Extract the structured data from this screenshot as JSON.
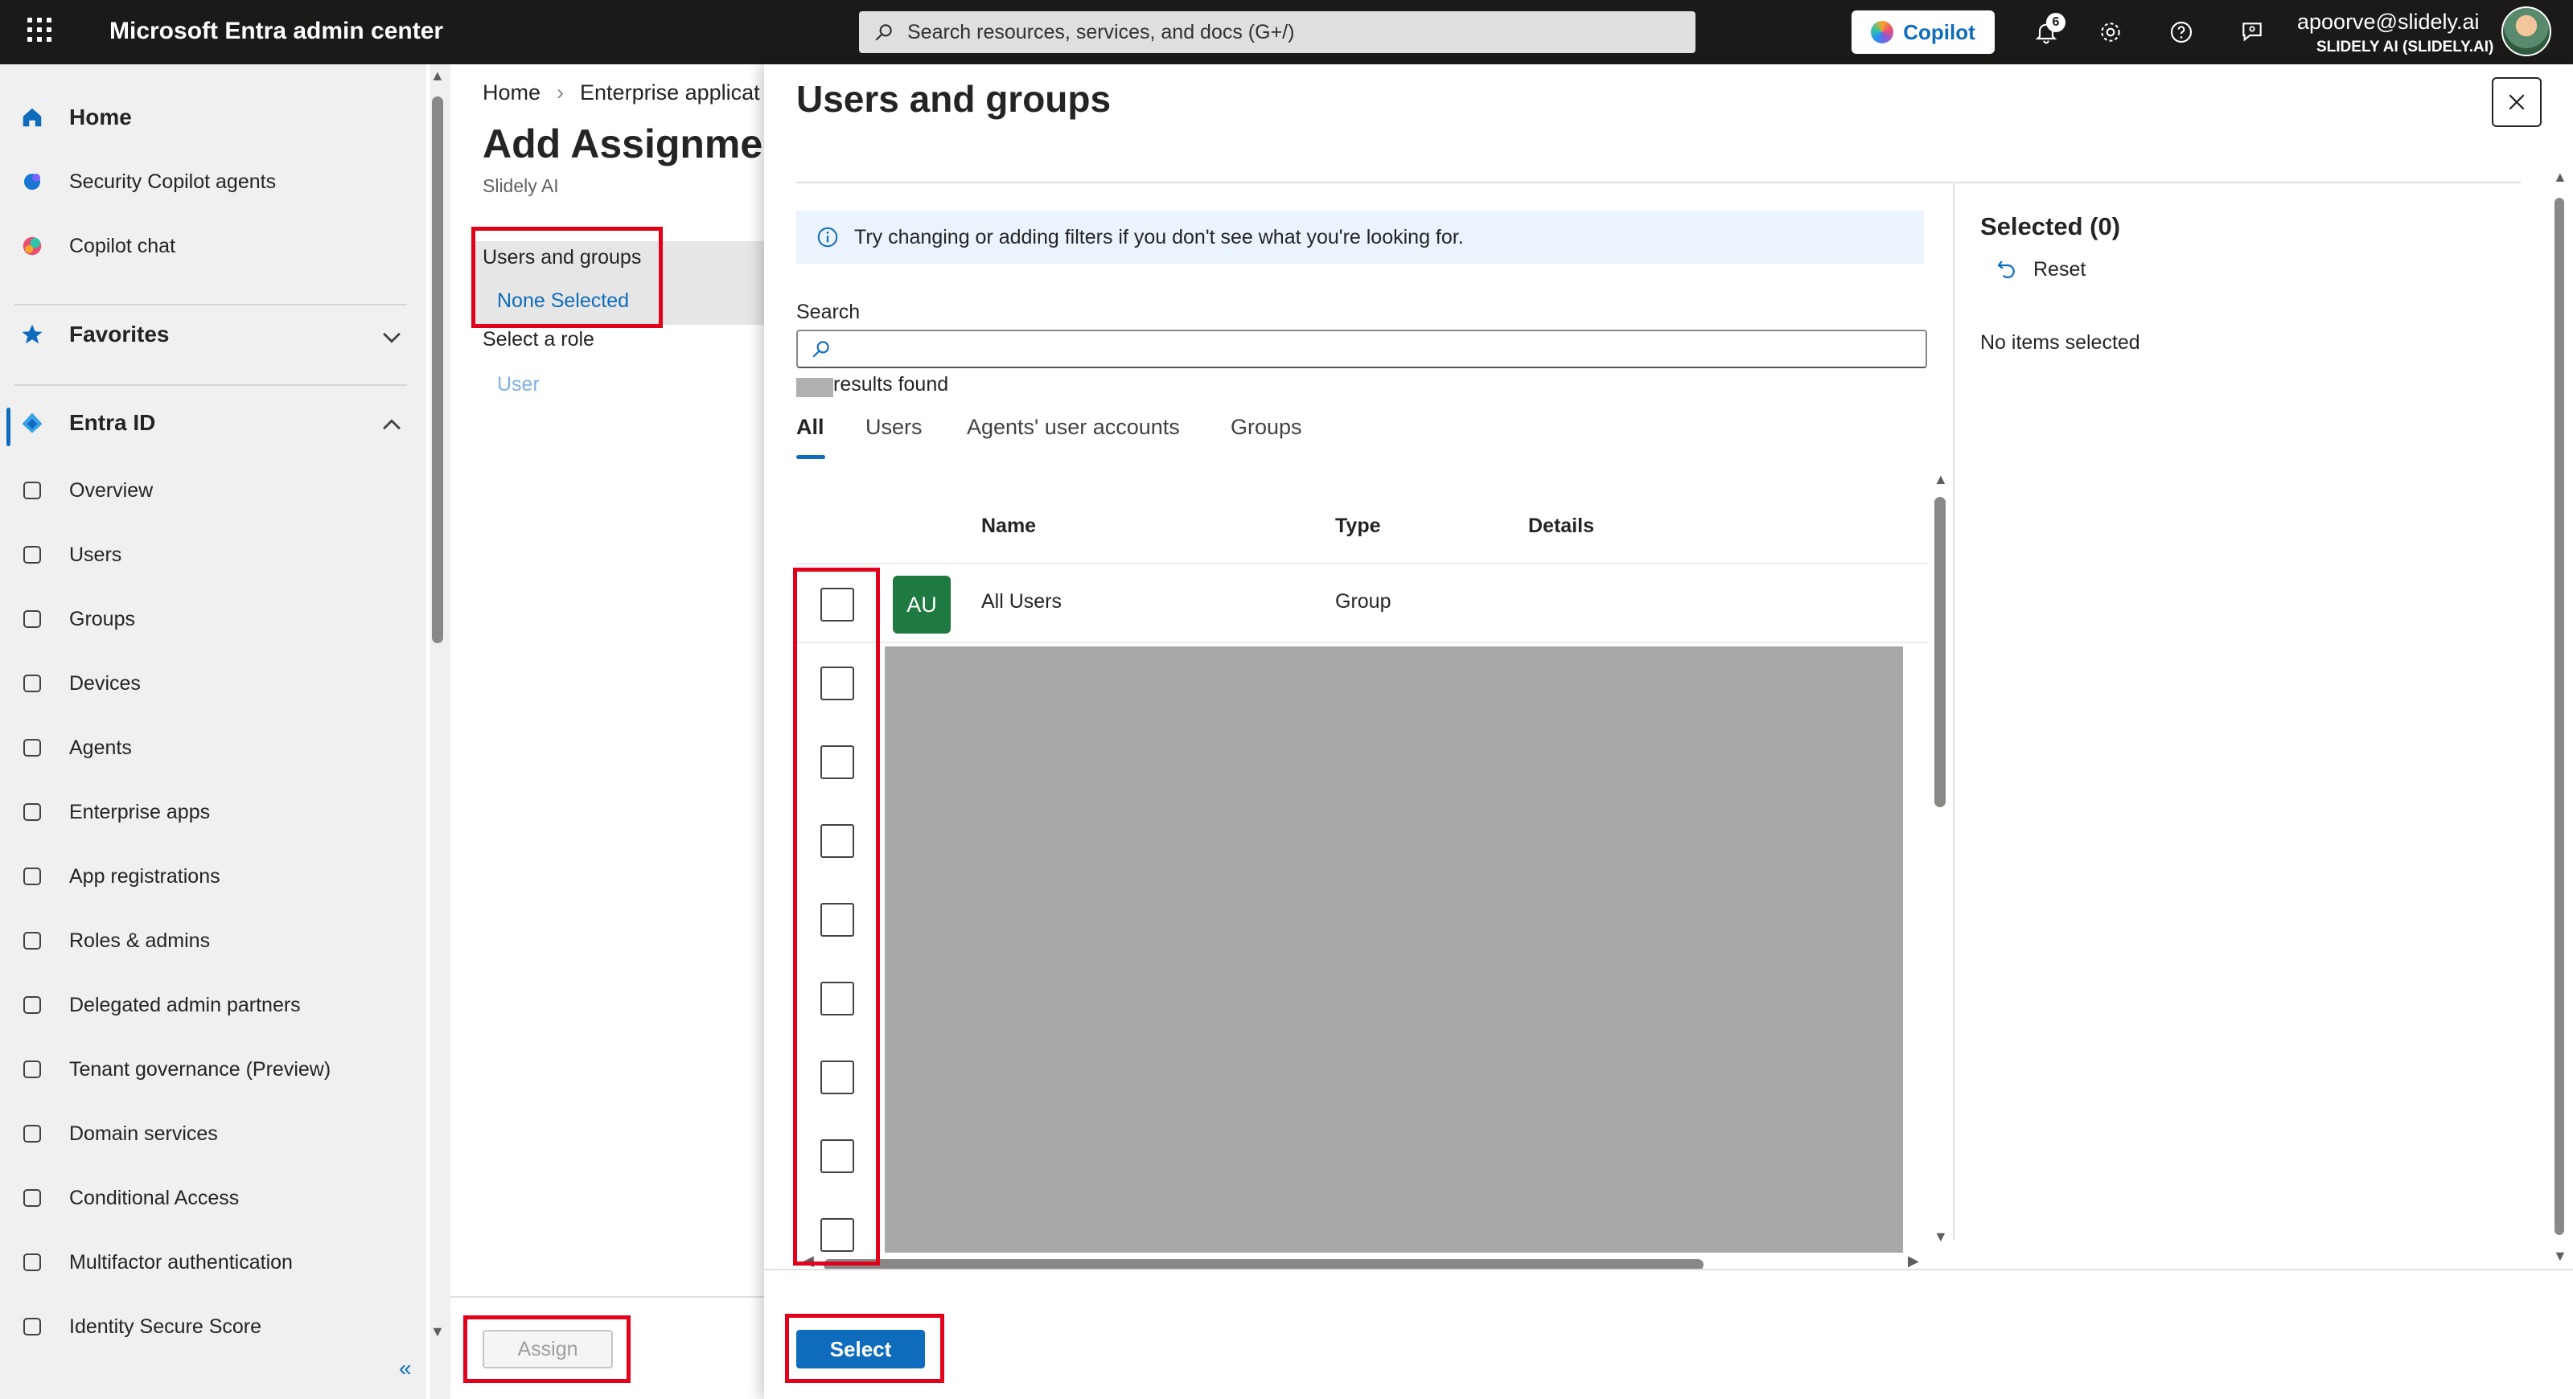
{
  "topbar": {
    "app_title": "Microsoft Entra admin center",
    "search_placeholder": "Search resources, services, and docs (G+/)",
    "copilot_label": "Copilot",
    "notification_count": "6",
    "user_email": "apoorve@slidely.ai",
    "user_tenant": "SLIDELY AI (SLIDELY.AI)"
  },
  "leftnav": {
    "items": [
      {
        "label": "Home",
        "icon": "home-icon"
      },
      {
        "label": "Security Copilot agents",
        "icon": "security-copilot-icon"
      },
      {
        "label": "Copilot chat",
        "icon": "copilot-icon"
      },
      {
        "label": "Favorites",
        "icon": "star-icon"
      },
      {
        "label": "Entra ID",
        "icon": "entra-id-icon"
      },
      {
        "label": "Overview",
        "icon": "info-icon"
      },
      {
        "label": "Users",
        "icon": "user-icon"
      },
      {
        "label": "Groups",
        "icon": "groups-icon"
      },
      {
        "label": "Devices",
        "icon": "devices-icon"
      },
      {
        "label": "Agents",
        "icon": "agents-icon"
      },
      {
        "label": "Enterprise apps",
        "icon": "enterprise-apps-icon"
      },
      {
        "label": "App registrations",
        "icon": "app-registrations-icon"
      },
      {
        "label": "Roles & admins",
        "icon": "roles-icon"
      },
      {
        "label": "Delegated admin partners",
        "icon": "delegated-partners-icon"
      },
      {
        "label": "Tenant governance (Preview)",
        "icon": "tenant-governance-icon"
      },
      {
        "label": "Domain services",
        "icon": "domain-services-icon"
      },
      {
        "label": "Conditional Access",
        "icon": "conditional-access-icon"
      },
      {
        "label": "Multifactor authentication",
        "icon": "mfa-icon"
      },
      {
        "label": "Identity Secure Score",
        "icon": "trophy-icon"
      }
    ],
    "collapse_glyph": "«"
  },
  "page": {
    "breadcrumb": [
      "Home",
      "Enterprise applicat"
    ],
    "breadcrumb_sep": "›",
    "title": "Add Assignment",
    "subtitle": "Slidely AI",
    "users_groups_label": "Users and groups",
    "users_groups_value": "None Selected",
    "role_label": "Select a role",
    "role_value": "User",
    "assign_label": "Assign"
  },
  "panel": {
    "title": "Users and groups",
    "info_text": "Try changing or adding filters if you don't see what you're looking for.",
    "search_label": "Search",
    "search_value": "",
    "results_text": "results found",
    "tabs": [
      "All",
      "Users",
      "Agents' user accounts",
      "Groups"
    ],
    "active_tab": "All",
    "columns": {
      "name": "Name",
      "type": "Type",
      "details": "Details"
    },
    "rows": [
      {
        "initials": "AU",
        "name": "All Users",
        "type": "Group",
        "details": ""
      }
    ],
    "checkbox_count": 9,
    "selected_title": "Selected (0)",
    "reset_label": "Reset",
    "no_items_text": "No items selected",
    "select_label": "Select"
  },
  "colors": {
    "accent": "#0f6cbd",
    "highlight": "#e3001b",
    "group_avatar": "#1e7a40",
    "topbar": "#1b1a19"
  }
}
